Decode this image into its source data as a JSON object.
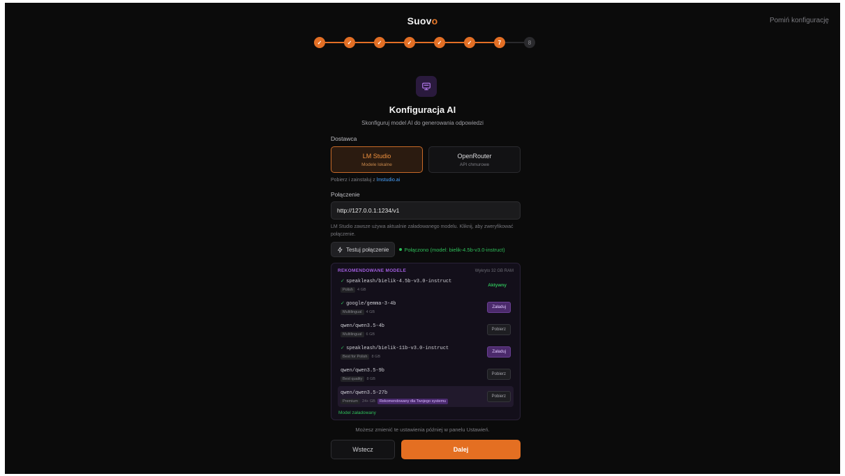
{
  "header": {
    "logo_main": "Suov",
    "logo_accent": "o",
    "skip_label": "Pomiń konfigurację"
  },
  "stepper": {
    "steps": [
      {
        "label": "✓",
        "state": "done"
      },
      {
        "label": "✓",
        "state": "done"
      },
      {
        "label": "✓",
        "state": "done"
      },
      {
        "label": "✓",
        "state": "done"
      },
      {
        "label": "✓",
        "state": "done"
      },
      {
        "label": "✓",
        "state": "done"
      },
      {
        "label": "7",
        "state": "current"
      },
      {
        "label": "8",
        "state": "pending"
      }
    ]
  },
  "hero": {
    "icon": "monitor-icon",
    "title": "Konfiguracja AI",
    "subtitle": "Skonfiguruj model AI do generowania odpowiedzi"
  },
  "provider": {
    "label": "Dostawca",
    "options": [
      {
        "name": "LM Studio",
        "desc": "Modele lokalne",
        "selected": true
      },
      {
        "name": "OpenRouter",
        "desc": "API chmurowe",
        "selected": false
      }
    ],
    "hint_prefix": "Pobierz i zainstaluj z ",
    "hint_link": "lmstudio.ai"
  },
  "connection": {
    "label": "Połączenie",
    "url_value": "http://127.0.0.1:1234/v1",
    "help": "LM Studio zawsze używa aktualnie załadowanego modelu. Kliknij, aby zweryfikować połączenie.",
    "test_label": "Testuj połączenie",
    "status": "Połączono (model: bielik-4.5b-v3.0-instruct)"
  },
  "models": {
    "title": "REKOMENDOWANE MODELE",
    "ram": "Wykryto 32 GB RAM",
    "items": [
      {
        "check": "✓ ",
        "name": "speakleash/bielik-4.5b-v3.0-instruct",
        "tag": "Polish",
        "size": "4 GB",
        "rec": "",
        "action": "Aktywny",
        "action_type": "active",
        "highlight": false
      },
      {
        "check": "✓ ",
        "name": "google/gemma-3-4b",
        "tag": "Multilingual",
        "size": "4 GB",
        "rec": "",
        "action": "Załaduj",
        "action_type": "load",
        "highlight": false
      },
      {
        "check": "",
        "name": "qwen/qwen3.5-4b",
        "tag": "Multilingual",
        "size": "6 GB",
        "rec": "",
        "action": "Pobierz",
        "action_type": "download",
        "highlight": false
      },
      {
        "check": "✓ ",
        "name": "speakleash/bielik-11b-v3.0-instruct",
        "tag": "Best for Polish",
        "size": "8 GB",
        "rec": "",
        "action": "Załaduj",
        "action_type": "load",
        "highlight": false
      },
      {
        "check": "",
        "name": "qwen/qwen3.5-9b",
        "tag": "Best quality",
        "size": "8 GB",
        "rec": "",
        "action": "Pobierz",
        "action_type": "download",
        "highlight": false
      },
      {
        "check": "",
        "name": "qwen/qwen3.5-27b",
        "tag": "Premium",
        "size": "24+ GB",
        "rec": "Rekomendowany dla Twojego systemu",
        "action": "Pobierz",
        "action_type": "download",
        "highlight": true
      }
    ],
    "footer": "Model załadowany"
  },
  "footer": {
    "note": "Możesz zmienić te ustawienia później w panelu Ustawień.",
    "back_label": "Wstecz",
    "next_label": "Dalej"
  },
  "colors": {
    "accent": "#e46f22",
    "purple": "#a25ee0",
    "success": "#2fbf5a",
    "background": "#0b0b0b"
  }
}
